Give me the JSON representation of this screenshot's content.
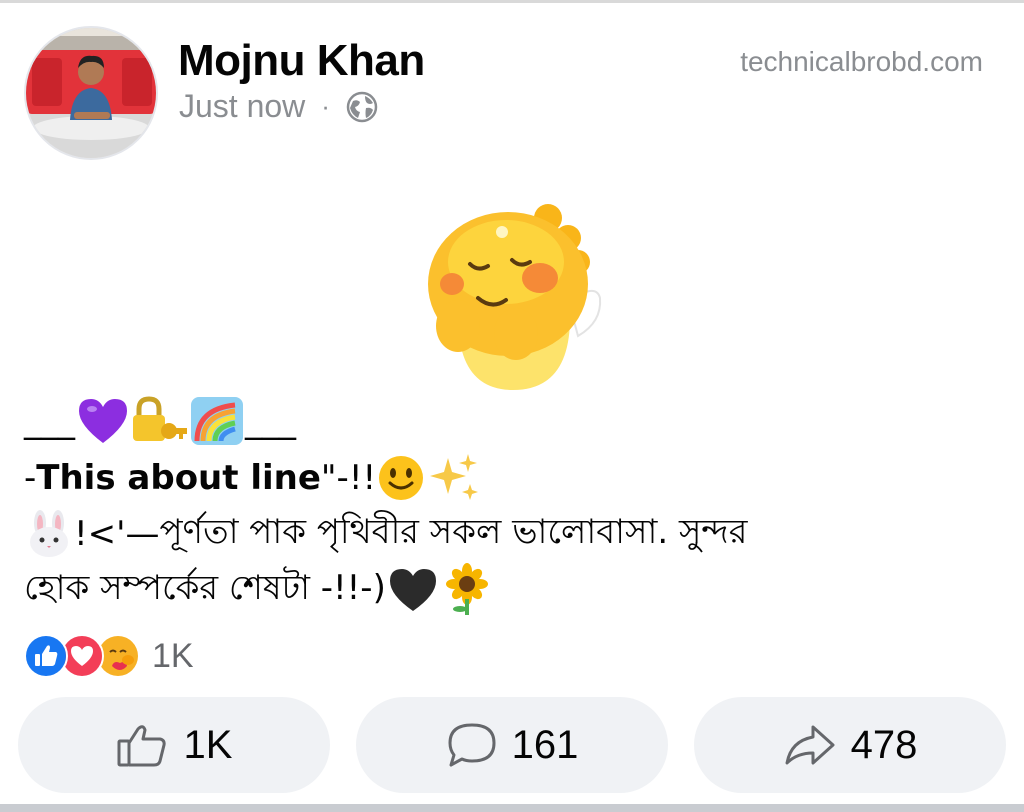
{
  "post": {
    "author_name": "Mojnu Khan",
    "timestamp": "Just now",
    "separator": "·",
    "privacy_icon": "globe-icon",
    "watermark": "technicalbrobd.com",
    "sticker_icon": "blushing-dinosaur-sticker"
  },
  "text": {
    "line1_dash_left": "___",
    "line1_dash_right": "___",
    "line2_prefix": "- ",
    "line2_bold": "This about line",
    "line2_suffix": "\"-!!",
    "line3_prefix": "!<'— ",
    "line3_bengali": "পূর্ণতা পাক পৃথিবীর সকল ভালোবাসা. সুন্দর",
    "line4_bengali": "হোক সম্পর্কের শেষটা -!!-)"
  },
  "reactions": {
    "icons": [
      "like-icon",
      "love-icon",
      "care-icon"
    ],
    "count": "1K"
  },
  "actions": {
    "like_count": "1K",
    "comment_count": "161",
    "share_count": "478"
  },
  "colors": {
    "meta_gray": "#8a8d91",
    "button_bg": "#f0f2f5",
    "like_blue": "#1877f2",
    "love_red": "#f33e58",
    "care_yellow": "#f7b125"
  }
}
